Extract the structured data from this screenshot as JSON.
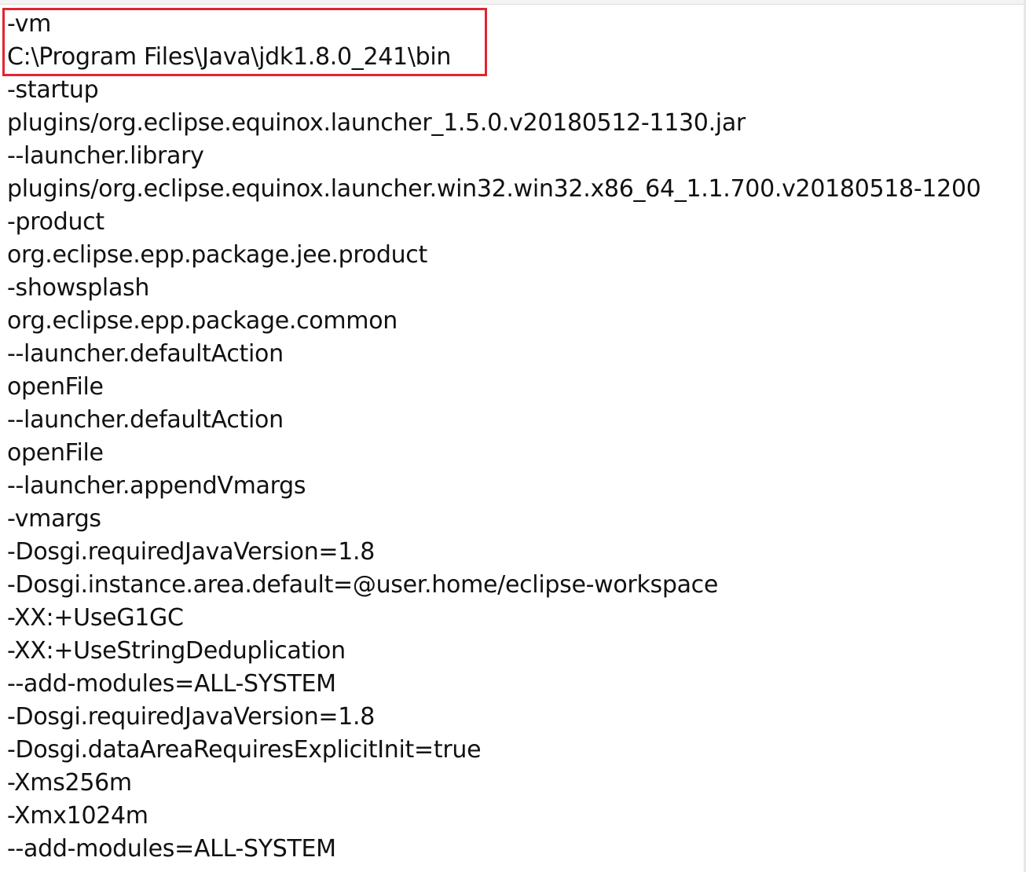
{
  "editor": {
    "lines": [
      "-vm",
      "C:\\Program Files\\Java\\jdk1.8.0_241\\bin",
      "-startup",
      "plugins/org.eclipse.equinox.launcher_1.5.0.v20180512-1130.jar",
      "--launcher.library",
      "plugins/org.eclipse.equinox.launcher.win32.win32.x86_64_1.1.700.v20180518-1200",
      "-product",
      "org.eclipse.epp.package.jee.product",
      "-showsplash",
      "org.eclipse.epp.package.common",
      "--launcher.defaultAction",
      "openFile",
      "--launcher.defaultAction",
      "openFile",
      "--launcher.appendVmargs",
      "-vmargs",
      "-Dosgi.requiredJavaVersion=1.8",
      "-Dosgi.instance.area.default=@user.home/eclipse-workspace",
      "-XX:+UseG1GC",
      "-XX:+UseStringDeduplication",
      "--add-modules=ALL-SYSTEM",
      "-Dosgi.requiredJavaVersion=1.8",
      "-Dosgi.dataAreaRequiresExplicitInit=true",
      "-Xms256m",
      "-Xmx1024m",
      "--add-modules=ALL-SYSTEM"
    ]
  },
  "highlight": {
    "color": "#e0262d"
  }
}
